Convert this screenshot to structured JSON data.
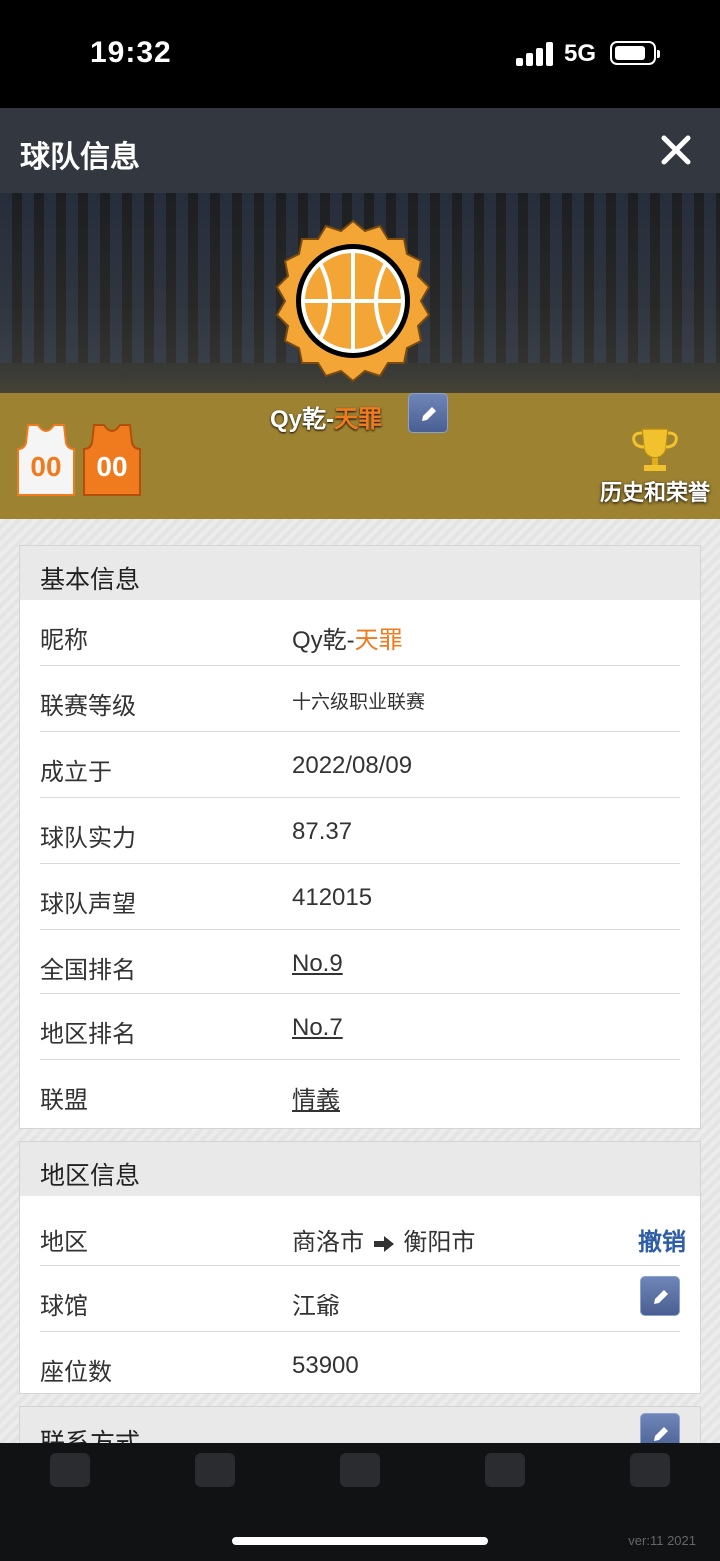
{
  "status_bar": {
    "time": "19:32",
    "network": "5G"
  },
  "header": {
    "title": "球队信息",
    "close_icon": "close-icon"
  },
  "banner": {
    "team_name_prefix": "Qy乾-",
    "team_name_highlight": "天罪",
    "jersey_number_1": "00",
    "jersey_number_2": "00",
    "honors_label": "历史和荣誉"
  },
  "basic_info": {
    "title": "基本信息",
    "nickname_label": "昵称",
    "nickname_prefix": "Qy乾-",
    "nickname_highlight": "天罪",
    "rows": [
      {
        "label": "联赛等级",
        "value": "十六级职业联赛"
      },
      {
        "label": "成立于",
        "value": "2022/08/09"
      },
      {
        "label": "球队实力",
        "value": "87.37"
      },
      {
        "label": "球队声望",
        "value": "412015"
      },
      {
        "label": "全国排名",
        "value": "No.9"
      },
      {
        "label": "地区排名",
        "value": "No.7"
      },
      {
        "label": "联盟",
        "value": "情義"
      }
    ]
  },
  "region_info": {
    "title": "地区信息",
    "region_label": "地区",
    "region_from": "商洛市",
    "region_to": "衡阳市",
    "revoke_label": "撤销",
    "arena_label": "球馆",
    "arena_value": "江爺",
    "seats_label": "座位数",
    "seats_value": "53900"
  },
  "contact": {
    "title": "联系方式"
  },
  "footer": {
    "version": "ver:11  2021"
  },
  "colors": {
    "accent_orange": "#f07a1e",
    "link_blue": "#2f5ea7",
    "alliance_red": "#e02020",
    "header_bg": "#33373f"
  }
}
